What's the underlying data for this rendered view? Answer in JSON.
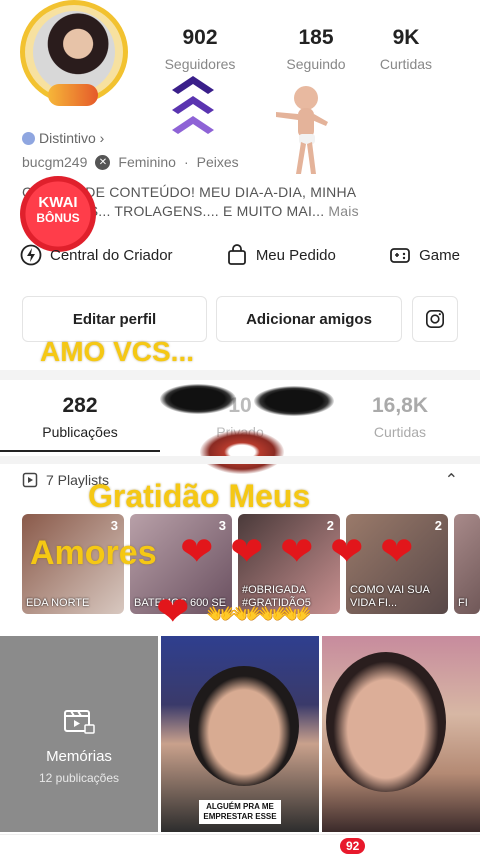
{
  "profile": {
    "stats": [
      {
        "value": "902",
        "label": "Seguidores"
      },
      {
        "value": "185",
        "label": "Seguindo"
      },
      {
        "value": "9K",
        "label": "Curtidas"
      }
    ],
    "distintivo": "Distintivo ›",
    "username": "bucgm249",
    "gender": "Feminino",
    "sign": "Peixes",
    "bio": "C          A DE CONTEÚDO! MEU DIA-A-DIA, MINHA            COMÉDIAS... TROLAGENS.... E MUITO MAI...",
    "bio_more": "Mais"
  },
  "kwai_bonus": {
    "line1": "KWAI",
    "line2": "BÔNUS"
  },
  "quick_actions": [
    {
      "label": "Central do Criador",
      "icon": "lightning-icon"
    },
    {
      "label": "Meu Pedido",
      "icon": "bag-icon"
    },
    {
      "label": "Game",
      "icon": "gamepad-icon"
    }
  ],
  "buttons": {
    "edit": "Editar perfil",
    "add_friends": "Adicionar amigos"
  },
  "overlays": {
    "amo": "AMO VCS...",
    "gratidao": "Gratidão Meus",
    "amores": "Amores"
  },
  "tabs": [
    {
      "value": "282",
      "label": "Publicações"
    },
    {
      "value": "10",
      "label": "Privado"
    },
    {
      "value": "16,8K",
      "label": "Curtidas"
    }
  ],
  "playlists": {
    "header": "7 Playlists",
    "items": [
      {
        "count": "3",
        "caption": "EDA NORTE"
      },
      {
        "count": "3",
        "caption": "BATEMOS 600 SE"
      },
      {
        "count": "2",
        "caption": "#OBRIGADA #GRATIDÃO5"
      },
      {
        "count": "2",
        "caption": "COMO VAI SUA VIDA FI..."
      },
      {
        "count": "",
        "caption": "FI"
      }
    ]
  },
  "grid": {
    "memories_title": "Memórias",
    "memories_sub": "12 publicações",
    "video_caption": "ALGUÉM PRA ME EMPRESTAR ESSE"
  },
  "bottom": {
    "badge": "92"
  },
  "colors": {
    "accent_yellow": "#f5c814",
    "heart_red": "#e2161b",
    "badge_red": "#e8192c"
  }
}
